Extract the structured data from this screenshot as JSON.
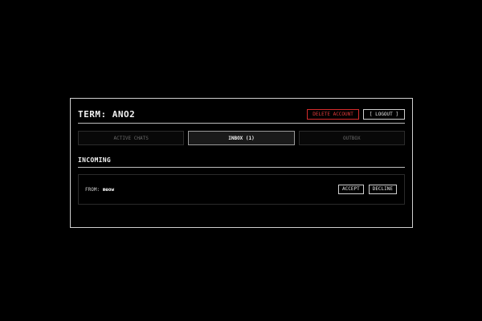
{
  "header": {
    "title": "TERM: ANO2",
    "delete_label": "DELETE ACCOUNT",
    "logout_label": "[ LOGOUT ]"
  },
  "tabs": [
    {
      "label": "ACTIVE CHATS",
      "active": false
    },
    {
      "label": "INBOX (1)",
      "active": true
    },
    {
      "label": "OUTBOX",
      "active": false
    }
  ],
  "section": {
    "title": "INCOMING"
  },
  "requests": [
    {
      "from_label": "FROM: ",
      "from_name": "meow",
      "accept_label": "ACCEPT",
      "decline_label": "DECLINE"
    }
  ],
  "colors": {
    "background": "#000000",
    "danger": "#e03a3a",
    "border": "#cfcfcf"
  }
}
